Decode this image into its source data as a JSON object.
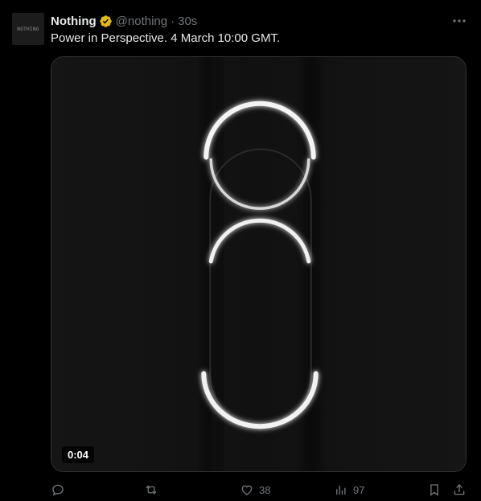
{
  "tweet": {
    "avatar_text": "NOTHING",
    "name": "Nothing",
    "handle": "@nothing",
    "separator": "·",
    "time": "30s",
    "more_glyph": "•••",
    "text": "Power in Perspective. 4 March 10:00 GMT.",
    "media": {
      "duration": "0:04"
    },
    "actions": {
      "reply_count": "",
      "retweet_count": "",
      "like_count": "38",
      "views_count": "97"
    },
    "icons": {
      "verified": "verified-badge-icon",
      "more": "more-icon",
      "reply": "reply-icon",
      "retweet": "retweet-icon",
      "like": "heart-icon",
      "views": "views-icon",
      "bookmark": "bookmark-icon",
      "share": "share-icon"
    },
    "colors": {
      "background": "#000000",
      "text": "#e7e9ea",
      "muted": "#71767b",
      "verified": "#e2b719"
    }
  }
}
